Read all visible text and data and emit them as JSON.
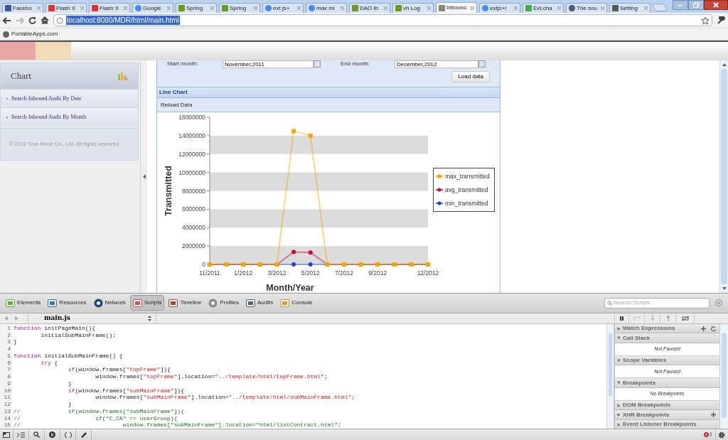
{
  "browser": {
    "tabs": [
      {
        "label": "Facebo",
        "kind": "facebook",
        "selected": false
      },
      {
        "label": "Flash X",
        "kind": "flash",
        "selected": false
      },
      {
        "label": "Flash X",
        "kind": "flash",
        "selected": false
      },
      {
        "label": "Google",
        "kind": "google",
        "selected": false
      },
      {
        "label": "Spring",
        "kind": "leaf",
        "selected": false
      },
      {
        "label": "Spring",
        "kind": "leaf",
        "selected": false
      },
      {
        "label": "ext js+",
        "kind": "google",
        "selected": false
      },
      {
        "label": "max mi",
        "kind": "google",
        "selected": false
      },
      {
        "label": "DAO Ib",
        "kind": "leaf",
        "selected": false
      },
      {
        "label": "vh Log",
        "kind": "leaf",
        "selected": false
      },
      {
        "label": "Inbounc",
        "kind": "page",
        "selected": true
      },
      {
        "label": "extjs+r",
        "kind": "google",
        "selected": false
      },
      {
        "label": "Ext.cha",
        "kind": "sprout",
        "selected": false
      },
      {
        "label": "The sou",
        "kind": "globe",
        "selected": false
      },
      {
        "label": "Setting",
        "kind": "wrench",
        "selected": false
      }
    ],
    "url": "localhost:8080/MDR/html/main.html",
    "bookmarks": [
      "PortableApps.com"
    ]
  },
  "sidebar": {
    "title": "Chart",
    "items": [
      "Search Inbound Audit By Date",
      "Search Inbound Audit By Month"
    ],
    "footer": "© 2012 True Move Co., Ltd. All rights reserved."
  },
  "form": {
    "start_label": "Start month:",
    "start_value": "November,2011",
    "end_label": "End month:",
    "end_value": "December,2012",
    "load_button": "Load data"
  },
  "chart_panel": {
    "title": "Line Chart",
    "toolbar_button": "Reload Data",
    "chart_data": {
      "type": "line",
      "xlabel": "Month/Year",
      "ylabel": "Transmitted",
      "categories": [
        "11/2011",
        null,
        "1/2012",
        null,
        "3/2012",
        null,
        "5/2012",
        null,
        "7/2012",
        null,
        "9/2012",
        null,
        null,
        "12/2012"
      ],
      "legend": "right",
      "ylim": [
        0,
        16000000
      ],
      "yticks": [
        0,
        2000000,
        4000000,
        6000000,
        8000000,
        10000000,
        12000000,
        14000000,
        16000000
      ],
      "series": [
        {
          "name": "max_transmitted",
          "color": "#f0a800",
          "marker": "square",
          "values": [
            0,
            0,
            0,
            0,
            0,
            14500000,
            14000000,
            0,
            0,
            0,
            0,
            0,
            0,
            0
          ]
        },
        {
          "name": "avg_transmitted",
          "color": "#cc0033",
          "marker": "circle",
          "values": [
            0,
            0,
            0,
            0,
            0,
            1350000,
            1300000,
            0,
            0,
            0,
            0,
            0,
            0,
            0
          ]
        },
        {
          "name": "min_transmitted",
          "color": "#2244bb",
          "marker": "circle",
          "values": [
            0,
            0,
            0,
            0,
            0,
            0,
            0,
            0,
            0,
            0,
            0,
            0,
            0,
            0
          ]
        }
      ]
    }
  },
  "devtools": {
    "panels": [
      {
        "label": "Elements",
        "kind": "elements",
        "selected": false
      },
      {
        "label": "Resources",
        "kind": "resources",
        "selected": false
      },
      {
        "label": "Network",
        "kind": "network",
        "selected": false
      },
      {
        "label": "Scripts",
        "kind": "scripts",
        "selected": true
      },
      {
        "label": "Timeline",
        "kind": "timeline",
        "selected": false
      },
      {
        "label": "Profiles",
        "kind": "profiles",
        "selected": false
      },
      {
        "label": "Audits",
        "kind": "audits",
        "selected": false
      },
      {
        "label": "Console",
        "kind": "console",
        "selected": false
      }
    ],
    "search_placeholder": "Search Scripts",
    "file": "main.js",
    "code": [
      {
        "number": "1",
        "tokens": [
          {
            "kind": "keyword",
            "text": "function"
          },
          {
            "kind": "plain",
            "text": " initPageMain(){"
          }
        ]
      },
      {
        "number": "2",
        "tokens": [
          {
            "kind": "plain",
            "text": "\tinitialSubMainFrame();"
          }
        ]
      },
      {
        "number": "3",
        "tokens": [
          {
            "kind": "plain",
            "text": "}"
          }
        ]
      },
      {
        "number": "4"
      },
      {
        "number": "5",
        "tokens": [
          {
            "kind": "keyword",
            "text": "function"
          },
          {
            "kind": "plain",
            "text": " initialSubMainFrame() {"
          }
        ]
      },
      {
        "number": "6",
        "tokens": [
          {
            "kind": "keyword",
            "text": "\ttry"
          },
          {
            "kind": "plain",
            "text": " {"
          }
        ]
      },
      {
        "number": "7",
        "tokens": [
          {
            "kind": "keyword",
            "text": "\t\tif"
          },
          {
            "kind": "plain",
            "text": "(window.frames["
          },
          {
            "kind": "string",
            "text": "\"topFrame\""
          },
          {
            "kind": "plain",
            "text": "]){"
          }
        ]
      },
      {
        "number": "8",
        "tokens": [
          {
            "kind": "plain",
            "text": "\t\t\twindow.frames["
          },
          {
            "kind": "string",
            "text": "\"topFrame\""
          },
          {
            "kind": "plain",
            "text": "].location="
          },
          {
            "kind": "string",
            "text": "\"../template/html/topFrame.html\""
          },
          {
            "kind": "plain",
            "text": ";"
          }
        ]
      },
      {
        "number": "9",
        "tokens": [
          {
            "kind": "plain",
            "text": "\t\t}"
          }
        ]
      },
      {
        "number": "10",
        "tokens": [
          {
            "kind": "keyword",
            "text": "\t\tif"
          },
          {
            "kind": "plain",
            "text": "(window.frames["
          },
          {
            "kind": "string",
            "text": "\"subMainFrame\""
          },
          {
            "kind": "plain",
            "text": "]){"
          }
        ]
      },
      {
        "number": "11",
        "tokens": [
          {
            "kind": "plain",
            "text": "\t\t\twindow.frames["
          },
          {
            "kind": "string",
            "text": "\"subMainFrame\""
          },
          {
            "kind": "plain",
            "text": "].location="
          },
          {
            "kind": "string",
            "text": "\"../template/html/subMainFrame.html\""
          },
          {
            "kind": "plain",
            "text": ";"
          }
        ]
      },
      {
        "number": "12",
        "tokens": [
          {
            "kind": "plain",
            "text": "\t\t}"
          }
        ]
      },
      {
        "number": "13",
        "tokens": [
          {
            "kind": "comment",
            "text": "//\t\tif(window.frames[\"subMainFrame\"]){"
          }
        ]
      },
      {
        "number": "14",
        "tokens": [
          {
            "kind": "comment",
            "text": "//\t\t\tif(\"C_CA\" == userGroup){"
          }
        ]
      },
      {
        "number": "15",
        "tokens": [
          {
            "kind": "comment",
            "text": "//\t\t\t\twindow.frames[\"subMainFrame\"].location=\"html/listContract.html\";"
          }
        ]
      }
    ],
    "sections": [
      {
        "title": "Watch Expressions",
        "expanded": false,
        "add_button": true,
        "refresh_button": true
      },
      {
        "title": "Call Stack",
        "expanded": true,
        "message": "Not Paused"
      },
      {
        "title": "Scope Variables",
        "expanded": true,
        "message": "Not Paused"
      },
      {
        "title": "Breakpoints",
        "expanded": true,
        "message": "No Breakpoints"
      },
      {
        "title": "DOM Breakpoints",
        "expanded": false
      },
      {
        "title": "XHR Breakpoints",
        "expanded": false,
        "add_button": true
      },
      {
        "title": "Event Listener Breakpoints",
        "expanded": false
      }
    ],
    "error_count": "1"
  }
}
